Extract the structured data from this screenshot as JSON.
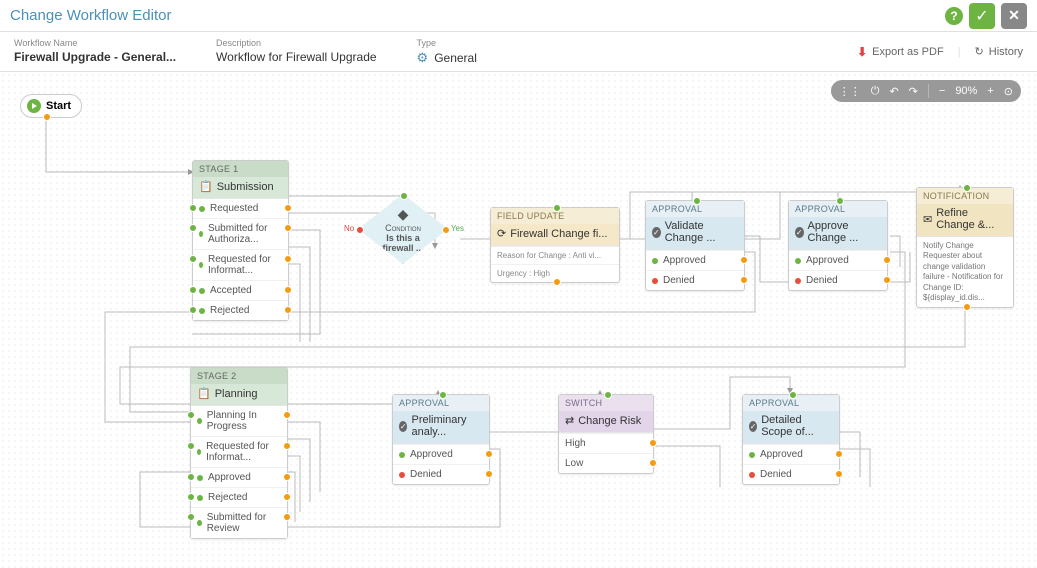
{
  "header": {
    "title": "Change Workflow Editor"
  },
  "info": {
    "name_label": "Workflow Name",
    "name_value": "Firewall Upgrade - General...",
    "desc_label": "Description",
    "desc_value": "Workflow for Firewall Upgrade",
    "type_label": "Type",
    "type_value": "General",
    "export": "Export as PDF",
    "history": "History"
  },
  "toolbar": {
    "zoom": "90%"
  },
  "start": {
    "label": "Start"
  },
  "stage1": {
    "hdr": "Stage 1",
    "title": "Submission",
    "rows": [
      "Requested",
      "Submitted for Authoriza...",
      "Requested for Informat...",
      "Accepted",
      "Rejected"
    ]
  },
  "condition": {
    "hdr": "Condition",
    "title": "Is this a firewall ...",
    "no": "No",
    "yes": "Yes"
  },
  "fupdate": {
    "hdr": "Field Update",
    "title": "Firewall Change fi...",
    "r1": "Reason for Change : Anti vi...",
    "r2": "Urgency : High"
  },
  "app1": {
    "hdr": "Approval",
    "title": "Validate Change ...",
    "ok": "Approved",
    "no": "Denied"
  },
  "app2": {
    "hdr": "Approval",
    "title": "Approve Change ...",
    "ok": "Approved",
    "no": "Denied"
  },
  "notif": {
    "hdr": "Notification",
    "title": "Refine Change &...",
    "body": "Notify Change Requester about change validation failure - Notification for Change ID: ${display_id.dis..."
  },
  "stage2": {
    "hdr": "Stage 2",
    "title": "Planning",
    "rows": [
      "Planning In Progress",
      "Requested for Informat...",
      "Approved",
      "Rejected",
      "Submitted for Review"
    ]
  },
  "app3": {
    "hdr": "Approval",
    "title": "Preliminary analy...",
    "ok": "Approved",
    "no": "Denied"
  },
  "switch": {
    "hdr": "Switch",
    "title": "Change Risk",
    "r1": "High",
    "r2": "Low"
  },
  "app4": {
    "hdr": "Approval",
    "title": "Detailed Scope of...",
    "ok": "Approved",
    "no": "Denied"
  }
}
